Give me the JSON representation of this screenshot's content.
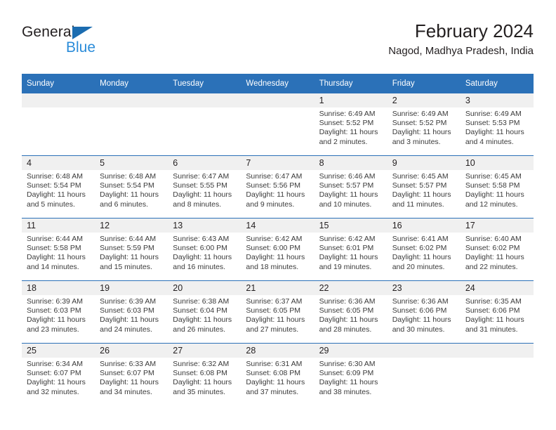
{
  "brand": {
    "name_top": "General",
    "name_bottom": "Blue",
    "accent_color": "#1b6cb0",
    "accent_light": "#2b8cd9",
    "flag_icon": "triangle-flag-icon"
  },
  "header": {
    "title": "February 2024",
    "subtitle": "Nagod, Madhya Pradesh, India"
  },
  "theme": {
    "header_blue": "#2b71b8",
    "daynum_gray": "#f0f0f0",
    "text_dark": "#231f20",
    "text_body": "#3a3a3a"
  },
  "weekdays": [
    "Sunday",
    "Monday",
    "Tuesday",
    "Wednesday",
    "Thursday",
    "Friday",
    "Saturday"
  ],
  "weeks": [
    [
      {
        "day": "",
        "lines": []
      },
      {
        "day": "",
        "lines": []
      },
      {
        "day": "",
        "lines": []
      },
      {
        "day": "",
        "lines": []
      },
      {
        "day": "1",
        "lines": [
          "Sunrise: 6:49 AM",
          "Sunset: 5:52 PM",
          "Daylight: 11 hours",
          "and 2 minutes."
        ]
      },
      {
        "day": "2",
        "lines": [
          "Sunrise: 6:49 AM",
          "Sunset: 5:52 PM",
          "Daylight: 11 hours",
          "and 3 minutes."
        ]
      },
      {
        "day": "3",
        "lines": [
          "Sunrise: 6:49 AM",
          "Sunset: 5:53 PM",
          "Daylight: 11 hours",
          "and 4 minutes."
        ]
      }
    ],
    [
      {
        "day": "4",
        "lines": [
          "Sunrise: 6:48 AM",
          "Sunset: 5:54 PM",
          "Daylight: 11 hours",
          "and 5 minutes."
        ]
      },
      {
        "day": "5",
        "lines": [
          "Sunrise: 6:48 AM",
          "Sunset: 5:54 PM",
          "Daylight: 11 hours",
          "and 6 minutes."
        ]
      },
      {
        "day": "6",
        "lines": [
          "Sunrise: 6:47 AM",
          "Sunset: 5:55 PM",
          "Daylight: 11 hours",
          "and 8 minutes."
        ]
      },
      {
        "day": "7",
        "lines": [
          "Sunrise: 6:47 AM",
          "Sunset: 5:56 PM",
          "Daylight: 11 hours",
          "and 9 minutes."
        ]
      },
      {
        "day": "8",
        "lines": [
          "Sunrise: 6:46 AM",
          "Sunset: 5:57 PM",
          "Daylight: 11 hours",
          "and 10 minutes."
        ]
      },
      {
        "day": "9",
        "lines": [
          "Sunrise: 6:45 AM",
          "Sunset: 5:57 PM",
          "Daylight: 11 hours",
          "and 11 minutes."
        ]
      },
      {
        "day": "10",
        "lines": [
          "Sunrise: 6:45 AM",
          "Sunset: 5:58 PM",
          "Daylight: 11 hours",
          "and 12 minutes."
        ]
      }
    ],
    [
      {
        "day": "11",
        "lines": [
          "Sunrise: 6:44 AM",
          "Sunset: 5:58 PM",
          "Daylight: 11 hours",
          "and 14 minutes."
        ]
      },
      {
        "day": "12",
        "lines": [
          "Sunrise: 6:44 AM",
          "Sunset: 5:59 PM",
          "Daylight: 11 hours",
          "and 15 minutes."
        ]
      },
      {
        "day": "13",
        "lines": [
          "Sunrise: 6:43 AM",
          "Sunset: 6:00 PM",
          "Daylight: 11 hours",
          "and 16 minutes."
        ]
      },
      {
        "day": "14",
        "lines": [
          "Sunrise: 6:42 AM",
          "Sunset: 6:00 PM",
          "Daylight: 11 hours",
          "and 18 minutes."
        ]
      },
      {
        "day": "15",
        "lines": [
          "Sunrise: 6:42 AM",
          "Sunset: 6:01 PM",
          "Daylight: 11 hours",
          "and 19 minutes."
        ]
      },
      {
        "day": "16",
        "lines": [
          "Sunrise: 6:41 AM",
          "Sunset: 6:02 PM",
          "Daylight: 11 hours",
          "and 20 minutes."
        ]
      },
      {
        "day": "17",
        "lines": [
          "Sunrise: 6:40 AM",
          "Sunset: 6:02 PM",
          "Daylight: 11 hours",
          "and 22 minutes."
        ]
      }
    ],
    [
      {
        "day": "18",
        "lines": [
          "Sunrise: 6:39 AM",
          "Sunset: 6:03 PM",
          "Daylight: 11 hours",
          "and 23 minutes."
        ]
      },
      {
        "day": "19",
        "lines": [
          "Sunrise: 6:39 AM",
          "Sunset: 6:03 PM",
          "Daylight: 11 hours",
          "and 24 minutes."
        ]
      },
      {
        "day": "20",
        "lines": [
          "Sunrise: 6:38 AM",
          "Sunset: 6:04 PM",
          "Daylight: 11 hours",
          "and 26 minutes."
        ]
      },
      {
        "day": "21",
        "lines": [
          "Sunrise: 6:37 AM",
          "Sunset: 6:05 PM",
          "Daylight: 11 hours",
          "and 27 minutes."
        ]
      },
      {
        "day": "22",
        "lines": [
          "Sunrise: 6:36 AM",
          "Sunset: 6:05 PM",
          "Daylight: 11 hours",
          "and 28 minutes."
        ]
      },
      {
        "day": "23",
        "lines": [
          "Sunrise: 6:36 AM",
          "Sunset: 6:06 PM",
          "Daylight: 11 hours",
          "and 30 minutes."
        ]
      },
      {
        "day": "24",
        "lines": [
          "Sunrise: 6:35 AM",
          "Sunset: 6:06 PM",
          "Daylight: 11 hours",
          "and 31 minutes."
        ]
      }
    ],
    [
      {
        "day": "25",
        "lines": [
          "Sunrise: 6:34 AM",
          "Sunset: 6:07 PM",
          "Daylight: 11 hours",
          "and 32 minutes."
        ]
      },
      {
        "day": "26",
        "lines": [
          "Sunrise: 6:33 AM",
          "Sunset: 6:07 PM",
          "Daylight: 11 hours",
          "and 34 minutes."
        ]
      },
      {
        "day": "27",
        "lines": [
          "Sunrise: 6:32 AM",
          "Sunset: 6:08 PM",
          "Daylight: 11 hours",
          "and 35 minutes."
        ]
      },
      {
        "day": "28",
        "lines": [
          "Sunrise: 6:31 AM",
          "Sunset: 6:08 PM",
          "Daylight: 11 hours",
          "and 37 minutes."
        ]
      },
      {
        "day": "29",
        "lines": [
          "Sunrise: 6:30 AM",
          "Sunset: 6:09 PM",
          "Daylight: 11 hours",
          "and 38 minutes."
        ]
      },
      {
        "day": "",
        "lines": []
      },
      {
        "day": "",
        "lines": []
      }
    ]
  ]
}
